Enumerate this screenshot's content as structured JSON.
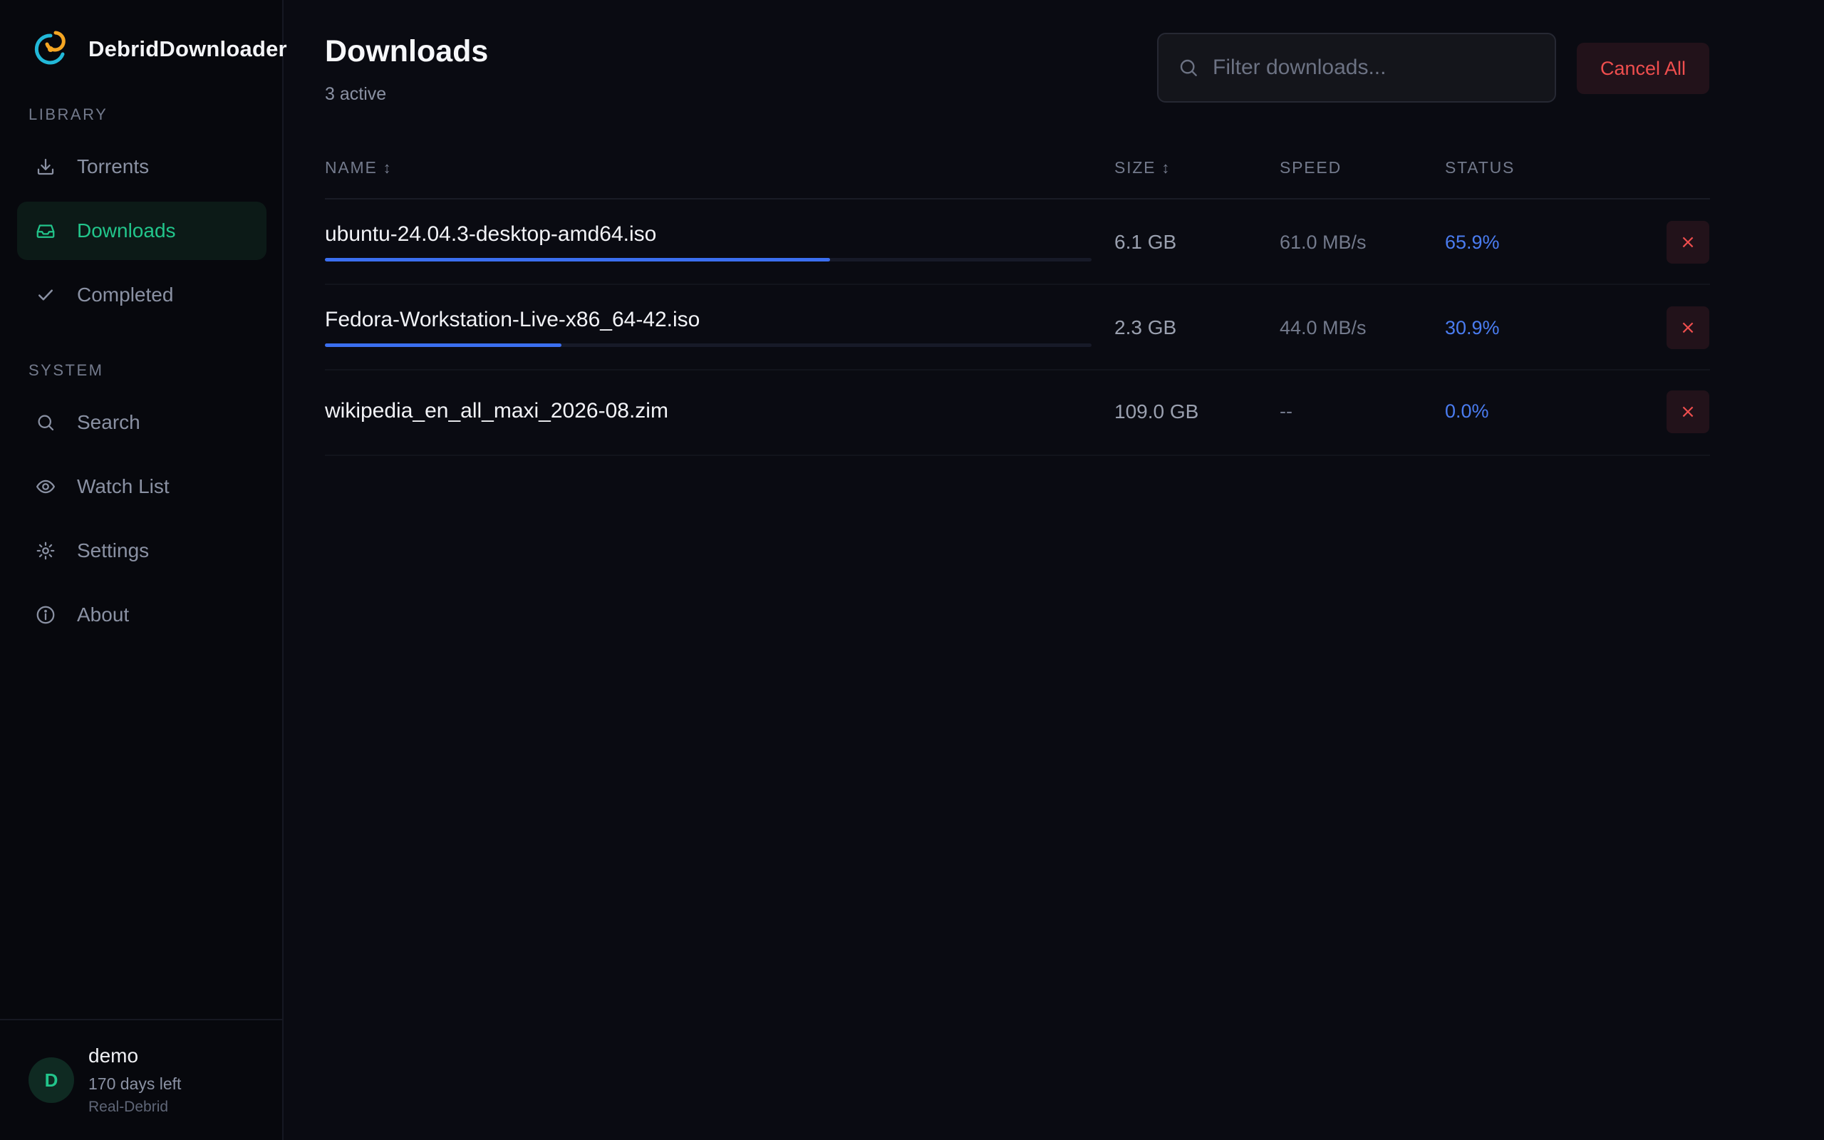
{
  "app": {
    "name": "DebridDownloader"
  },
  "sidebar": {
    "sections": [
      {
        "label": "LIBRARY"
      },
      {
        "label": "SYSTEM"
      }
    ],
    "items": [
      {
        "label": "Torrents",
        "icon": "download-icon",
        "active": false
      },
      {
        "label": "Downloads",
        "icon": "inbox-icon",
        "active": true
      },
      {
        "label": "Completed",
        "icon": "check-icon",
        "active": false
      },
      {
        "label": "Search",
        "icon": "search-icon",
        "active": false
      },
      {
        "label": "Watch List",
        "icon": "eye-icon",
        "active": false
      },
      {
        "label": "Settings",
        "icon": "sun-gear-icon",
        "active": false
      },
      {
        "label": "About",
        "icon": "info-icon",
        "active": false
      }
    ],
    "user": {
      "initial": "D",
      "name": "demo",
      "days_left": "170 days left",
      "service": "Real-Debrid"
    }
  },
  "header": {
    "title": "Downloads",
    "subtitle": "3 active",
    "search": {
      "placeholder": "Filter downloads...",
      "value": ""
    },
    "cancel_all_label": "Cancel All"
  },
  "table": {
    "columns": {
      "name": "NAME",
      "size": "SIZE",
      "speed": "SPEED",
      "status": "STATUS"
    },
    "sort_glyph": "↕",
    "rows": [
      {
        "name": "ubuntu-24.04.3-desktop-amd64.iso",
        "size": "6.1 GB",
        "speed": "61.0 MB/s",
        "status": "65.9%",
        "progress": 0.659,
        "show_bar": true
      },
      {
        "name": "Fedora-Workstation-Live-x86_64-42.iso",
        "size": "2.3 GB",
        "speed": "44.0 MB/s",
        "status": "30.9%",
        "progress": 0.309,
        "show_bar": true
      },
      {
        "name": "wikipedia_en_all_maxi_2026-08.zim",
        "size": "109.0 GB",
        "speed": "--",
        "status": "0.0%",
        "progress": 0.0,
        "show_bar": false
      }
    ],
    "cancel_glyph": "×"
  },
  "colors": {
    "accent": "#22c58b",
    "progress": "#3b6ff0",
    "status": "#4a7cf0",
    "danger": "#ef4e4e",
    "background": "#0a0b12"
  }
}
